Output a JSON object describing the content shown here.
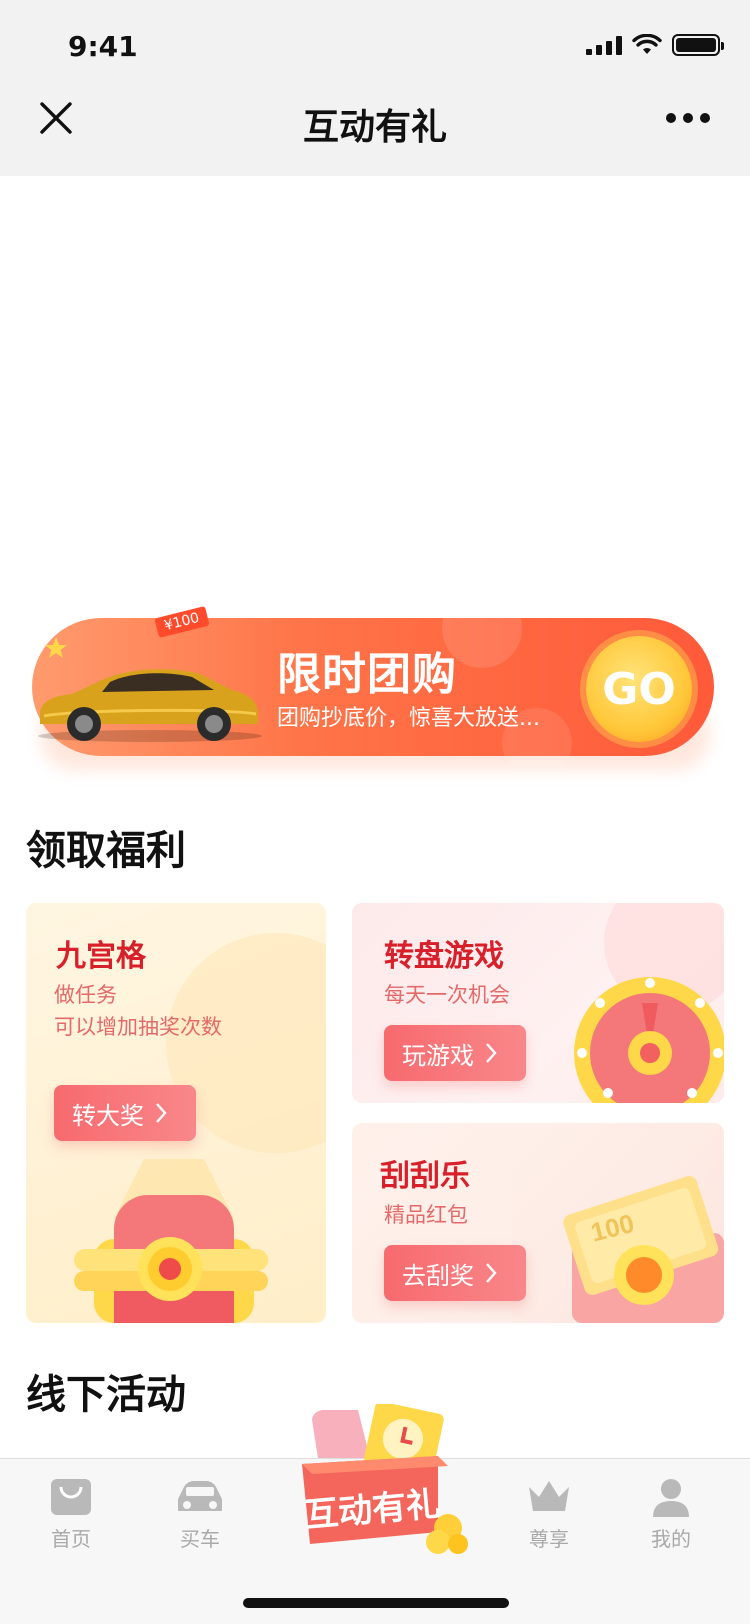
{
  "status_bar": {
    "time": "9:41"
  },
  "nav": {
    "title": "互动有礼"
  },
  "banner": {
    "title": "限时团购",
    "subtitle": "团购抄底价，惊喜大放送...",
    "go_label": "GO",
    "price_tag": "¥100"
  },
  "sections": {
    "benefits_title": "领取福利",
    "offline_title": "线下活动"
  },
  "cards": {
    "grid": {
      "title": "九宫格",
      "desc_line1": "做任务",
      "desc_line2": "可以增加抽奖次数",
      "button": "转大奖"
    },
    "wheel": {
      "title": "转盘游戏",
      "desc": "每天一次机会",
      "button": "玩游戏"
    },
    "scratch": {
      "title": "刮刮乐",
      "desc": "精品红包",
      "button": "去刮奖",
      "note_value": "100"
    }
  },
  "tabbar": {
    "items": [
      {
        "label": "首页",
        "icon": "bag-icon"
      },
      {
        "label": "买车",
        "icon": "car-icon"
      },
      {
        "label": "互动有礼",
        "icon": "gift-box-icon"
      },
      {
        "label": "尊享",
        "icon": "crown-icon"
      },
      {
        "label": "我的",
        "icon": "user-icon"
      }
    ]
  },
  "colors": {
    "accent_red": "#d8202b",
    "banner_orange": "#ff7448",
    "button_pink": "#f76a6e",
    "tab_inactive": "#a9a9a9"
  }
}
